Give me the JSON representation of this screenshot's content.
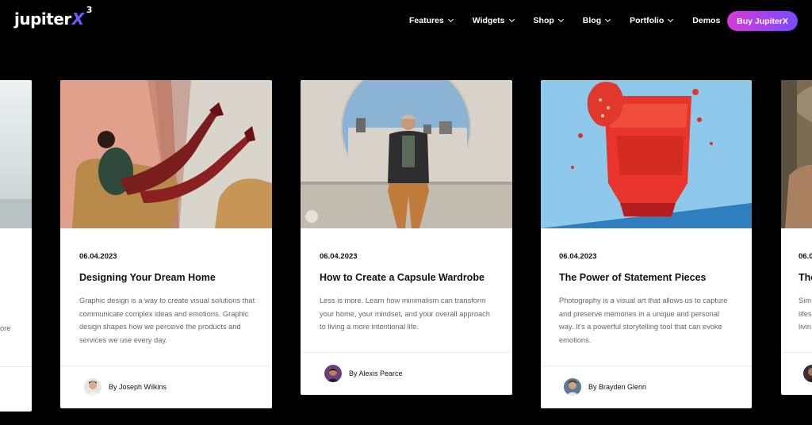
{
  "header": {
    "logo_text": "jupiter",
    "logo_x": "X",
    "logo_version": "3",
    "nav": [
      {
        "label": "Features"
      },
      {
        "label": "Widgets"
      },
      {
        "label": "Shop"
      },
      {
        "label": "Blog"
      },
      {
        "label": "Portfolio"
      },
      {
        "label": "Demos"
      }
    ],
    "buy_label": "Buy JupiterX"
  },
  "cards": [
    {
      "date": "06.04.2023",
      "title": "Designing Your Dream Home",
      "excerpt": "Graphic design is a way to create visual solutions that communicate complex ideas and emotions. Graphic design shapes how we perceive the products and services we use every day.",
      "author": "By Joseph Wilkins"
    },
    {
      "date": "06.04.2023",
      "title": "How to Create a Capsule Wardrobe",
      "excerpt": "Less is more. Learn how minimalism can transform your home, your mindset, and your overall approach to living a more intentional life.",
      "author": "By Alexis Pearce"
    },
    {
      "date": "06.04.2023",
      "title": "The Power of Statement Pieces",
      "excerpt": "Photography is a visual art that allows us to capture and preserve memories in a unique and personal way. It's a powerful storytelling tool that can evoke emotions.",
      "author": "By Brayden Glenn"
    }
  ],
  "partial_left": {
    "excerpt_fragment": "ore"
  },
  "partial_right": {
    "date_fragment": "06.0",
    "title_fragment": "The",
    "excerpt_fragments": [
      "Sim",
      "lifes",
      "livin"
    ]
  }
}
